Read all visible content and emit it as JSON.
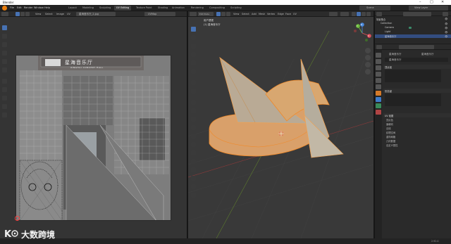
{
  "window": {
    "title": "Blender",
    "controls": {
      "minimize": "–",
      "maximize": "□",
      "close": "✕"
    }
  },
  "menubar": {
    "items": [
      "File",
      "Edit",
      "Render",
      "Window",
      "Help"
    ],
    "workspaces": [
      "Layout",
      "Modeling",
      "Sculpting",
      "UV Editing",
      "Texture Paint",
      "Shading",
      "Animation",
      "Rendering",
      "Compositing",
      "Scripting"
    ],
    "active_workspace": "UV Editing",
    "scene_label": "Scene",
    "view_layer_label": "View Layer"
  },
  "uv_editor": {
    "header_menu": [
      "View",
      "Select",
      "Image",
      "UV"
    ],
    "image_name": "星海音乐厅_2.jpg",
    "uv_map": "UVMap",
    "texture_sign_cn": "星海音乐厅",
    "texture_sign_en": "XINGHAI CONCERT HALL"
  },
  "viewport": {
    "header_menu": [
      "View",
      "Select",
      "Add",
      "Mesh",
      "Vertex",
      "Edge",
      "Face",
      "UV"
    ],
    "mode": "Edit Mode",
    "overlay_line1": "用户透视",
    "overlay_line2": "(1) 星海音乐厅",
    "nav_axes": {
      "x": "X",
      "y": "Y",
      "z": "Z"
    }
  },
  "outliner": {
    "rows": [
      {
        "label": "场景集合",
        "indent": 0,
        "selected": false
      },
      {
        "label": "Collection",
        "indent": 1,
        "selected": false
      },
      {
        "label": "Camera",
        "indent": 2,
        "selected": false
      },
      {
        "label": "Light",
        "indent": 2,
        "selected": false
      },
      {
        "label": "星海音乐厅",
        "indent": 2,
        "selected": true
      }
    ]
  },
  "properties": {
    "search_placeholder": "",
    "object_name": "星海音乐厅",
    "mesh_name": "星海音乐厅",
    "data_field": "星海音乐厅",
    "panels": [
      {
        "label": "顶点组",
        "open": true
      },
      {
        "label": "形态键",
        "open": true
      },
      {
        "label": "UV 贴图",
        "open": true
      }
    ],
    "sub_items": [
      "顶点色",
      "面朝向",
      "法线",
      "纹理空间",
      "重构网格",
      "几何数据",
      "自定义属性"
    ]
  },
  "watermark": {
    "text": "大数跨境"
  },
  "statusbar": {
    "version": "2.92.0"
  },
  "colors": {
    "accent": "#4772b3",
    "mesh_face": "#a89a8c",
    "mesh_edge": "#e0853a",
    "uv_grid": "#8a8a8a"
  }
}
